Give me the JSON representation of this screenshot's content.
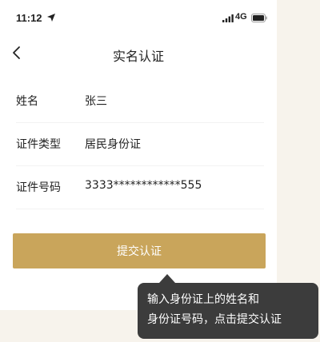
{
  "status_bar": {
    "time": "11:12",
    "network": "4G",
    "icons": [
      "location-arrow-icon",
      "signal-icon",
      "battery-icon"
    ]
  },
  "nav": {
    "title": "实名认证",
    "back_icon": "chevron-left-icon"
  },
  "form": {
    "rows": [
      {
        "label": "姓名",
        "value": "张三"
      },
      {
        "label": "证件类型",
        "value": "居民身份证"
      },
      {
        "label": "证件号码",
        "value": "3333************555"
      }
    ]
  },
  "submit": {
    "label": "提交认证"
  },
  "tooltip": {
    "line1": "输入身份证上的姓名和",
    "line2": "身份证号码，点击提交认证"
  },
  "colors": {
    "accent": "#c9a55b",
    "tooltip_bg": "#3c3c3c",
    "page_bg": "#f7f3ec"
  }
}
